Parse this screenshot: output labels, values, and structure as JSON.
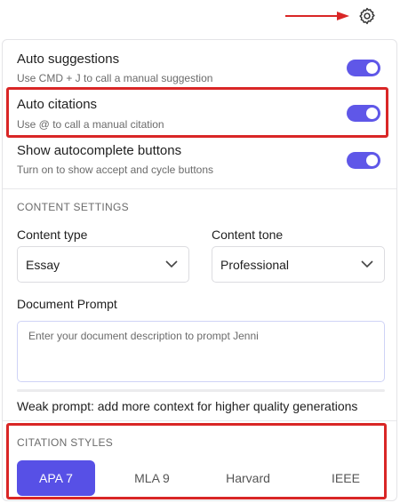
{
  "toggles": [
    {
      "title": "Auto suggestions",
      "subtitle": "Use CMD + J to call a manual suggestion",
      "on": true
    },
    {
      "title": "Auto citations",
      "subtitle": "Use @ to call a manual citation",
      "on": true
    },
    {
      "title": "Show autocomplete buttons",
      "subtitle": "Turn on to show accept and cycle buttons",
      "on": true
    }
  ],
  "content_settings": {
    "heading": "CONTENT SETTINGS",
    "type_label": "Content type",
    "type_value": "Essay",
    "tone_label": "Content tone",
    "tone_value": "Professional",
    "prompt_label": "Document Prompt",
    "prompt_placeholder": "Enter your document description to prompt Jenni",
    "weak_prompt": "Weak prompt: add more context for higher quality generations"
  },
  "citation_styles": {
    "heading": "CITATION STYLES",
    "options": [
      "APA 7",
      "MLA 9",
      "Harvard",
      "IEEE"
    ],
    "selected": "APA 7"
  },
  "colors": {
    "accent": "#5750e6",
    "annotation": "#d92626"
  },
  "icons": {
    "settings": "gear-icon",
    "select_chevron": "chevron-down-icon"
  }
}
